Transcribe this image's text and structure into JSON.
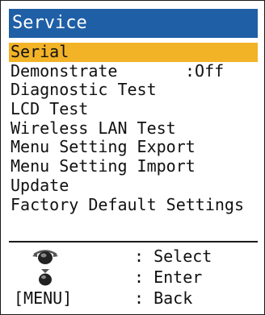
{
  "title": "Service",
  "menu": {
    "items": [
      {
        "label": "Serial",
        "value": "",
        "selected": true
      },
      {
        "label": "Demonstrate",
        "value": ":Off",
        "selected": false
      },
      {
        "label": "Diagnostic Test",
        "value": "",
        "selected": false
      },
      {
        "label": "LCD Test",
        "value": "",
        "selected": false
      },
      {
        "label": "Wireless LAN Test",
        "value": "",
        "selected": false
      },
      {
        "label": "Menu Setting Export",
        "value": "",
        "selected": false
      },
      {
        "label": "Menu Setting Import",
        "value": "",
        "selected": false
      },
      {
        "label": "Update",
        "value": "",
        "selected": false
      },
      {
        "label": "Factory Default Settings",
        "value": "",
        "selected": false
      }
    ]
  },
  "help": {
    "rows": [
      {
        "key_icon": "rotary-knob-rotate-icon",
        "key_text": "",
        "action": ": Select"
      },
      {
        "key_icon": "rotary-knob-push-icon",
        "key_text": "",
        "action": ": Enter"
      },
      {
        "key_icon": "",
        "key_text": "[MENU]",
        "action": ": Back"
      }
    ]
  },
  "colors": {
    "title_bar": "#1f5fa6",
    "title_text": "#ffffff",
    "selection": "#f2b327",
    "text": "#111111"
  }
}
